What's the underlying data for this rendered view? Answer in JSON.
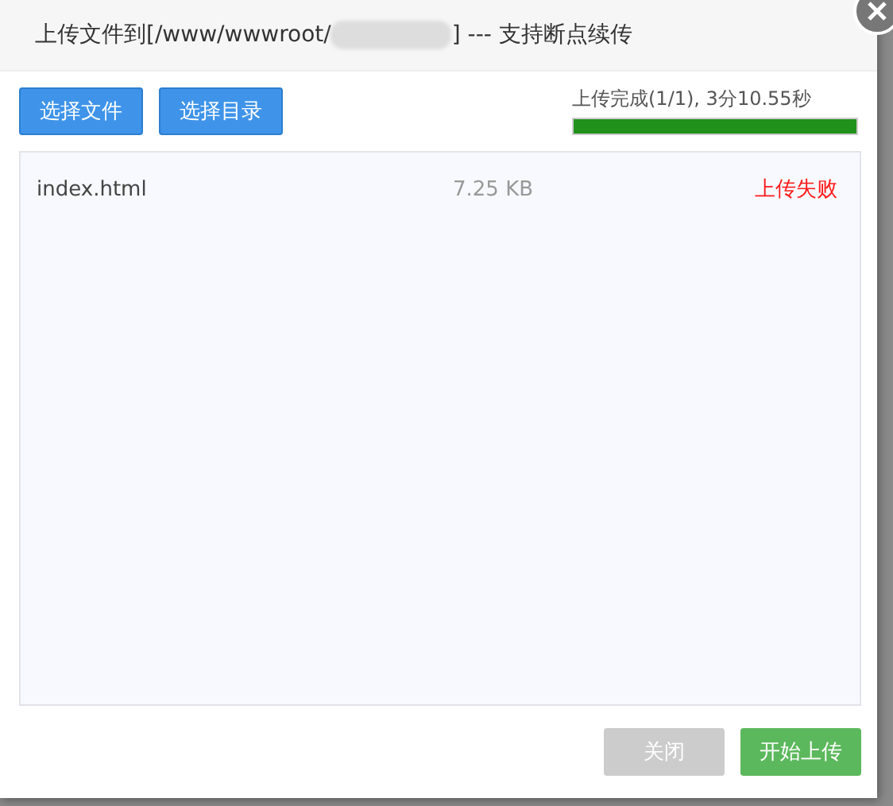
{
  "dialog": {
    "title_prefix": "上传文件到[/www/wwwroot/",
    "title_suffix": "] --- 支持断点续传",
    "title_redacted": true
  },
  "toolbar": {
    "buttons": [
      "选择文件",
      "选择目录"
    ],
    "progress": {
      "text": "上传完成(1/1), 3分10.55秒",
      "level": 1
    }
  },
  "files": [
    {
      "name": "index.html",
      "size": "7.25 KB",
      "status": "上传失败",
      "kind": "failed"
    }
  ],
  "footer": {
    "buttons": [
      {
        "label": "关闭",
        "disabled": true,
        "kind": "close"
      },
      {
        "label": "开始上传",
        "disabled": false,
        "kind": "start"
      }
    ]
  }
}
